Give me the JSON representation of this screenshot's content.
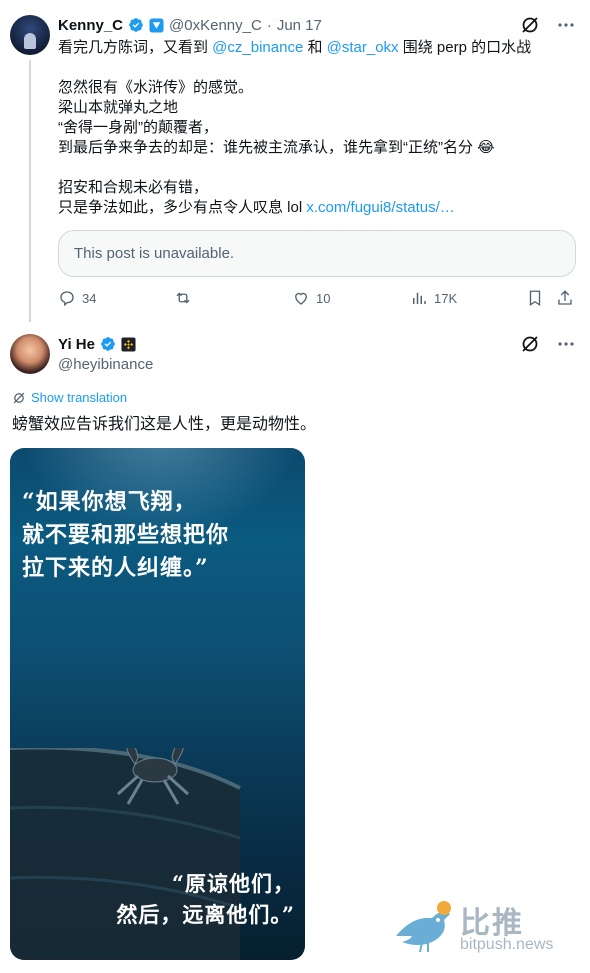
{
  "tweet1": {
    "author_name": "Kenny_C",
    "handle": "@0xKenny_C",
    "separator": "·",
    "date": "Jun 17",
    "lines": [
      {
        "parts": [
          {
            "t": "看完几方陈词，又看到 "
          },
          {
            "t": "@cz_binance",
            "link": true
          },
          {
            "t": " 和 "
          },
          {
            "t": "@star_okx",
            "link": true
          },
          {
            "t": " 围绕 perp 的口水战"
          }
        ]
      },
      {
        "gap": true
      },
      {
        "parts": [
          {
            "t": "忽然很有《水浒传》的感觉。"
          }
        ]
      },
      {
        "parts": [
          {
            "t": "梁山本就弹丸之地"
          }
        ]
      },
      {
        "parts": [
          {
            "t": "“舍得一身剐”的颠覆者，"
          }
        ]
      },
      {
        "parts": [
          {
            "t": "到最后争来争去的却是：谁先被主流承认，谁先拿到“正统”名分 😂"
          }
        ]
      },
      {
        "gap": true
      },
      {
        "parts": [
          {
            "t": "招安和合规未必有错，"
          }
        ]
      },
      {
        "parts": [
          {
            "t": "只是争法如此，多少有点令人叹息 lol "
          },
          {
            "t": "x.com/fugui8/status/…",
            "link": true
          }
        ]
      }
    ],
    "quote_text": "This post is unavailable.",
    "stats": {
      "replies": "34",
      "reposts": "",
      "likes": "10",
      "views": "17K"
    }
  },
  "tweet2": {
    "author_name": "Yi He",
    "handle": "@heyibinance",
    "show_translation": "Show translation",
    "text": "螃蟹效应告诉我们这是人性，更是动物性。",
    "poster_quote_top": "“如果你想飞翔，\n就不要和那些想把你\n拉下来的人纠缠。”",
    "poster_quote_bottom": "“原谅他们，\n然后，远离他们。”"
  },
  "watermark": {
    "cn": "比推",
    "en": "bitpush.news"
  },
  "colors": {
    "accent": "#1d9bf0",
    "muted": "#536471",
    "binance": "#f0b90b",
    "verified": "#1d9bf0"
  }
}
